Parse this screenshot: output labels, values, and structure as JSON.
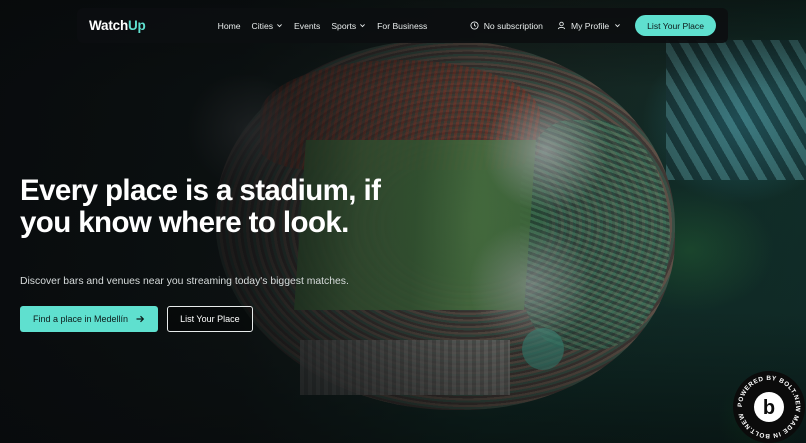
{
  "brand": {
    "name_main": "Watch",
    "name_accent": "Up",
    "accent_color": "#5fe0cf"
  },
  "nav": {
    "links": [
      {
        "label": "Home",
        "has_dropdown": false
      },
      {
        "label": "Cities",
        "has_dropdown": true
      },
      {
        "label": "Events",
        "has_dropdown": false
      },
      {
        "label": "Sports",
        "has_dropdown": true
      },
      {
        "label": "For Business",
        "has_dropdown": false
      }
    ],
    "subscription_status": "No subscription",
    "profile_label": "My Profile",
    "list_button_label": "List Your Place"
  },
  "hero": {
    "title": "Every place is a stadium, if you know where to look.",
    "subtitle": "Discover bars and venues near you streaming today's biggest matches.",
    "primary_cta": "Find a place in Medellín",
    "secondary_cta": "List Your Place"
  },
  "badge": {
    "text": "POWERED BY BOLT.NEW MADE IN BOLT.NEW",
    "letter": "b"
  },
  "icons": {
    "clock": "clock-icon",
    "user": "user-icon",
    "arrow": "arrow-right-icon",
    "chevron": "chevron-down-icon"
  }
}
